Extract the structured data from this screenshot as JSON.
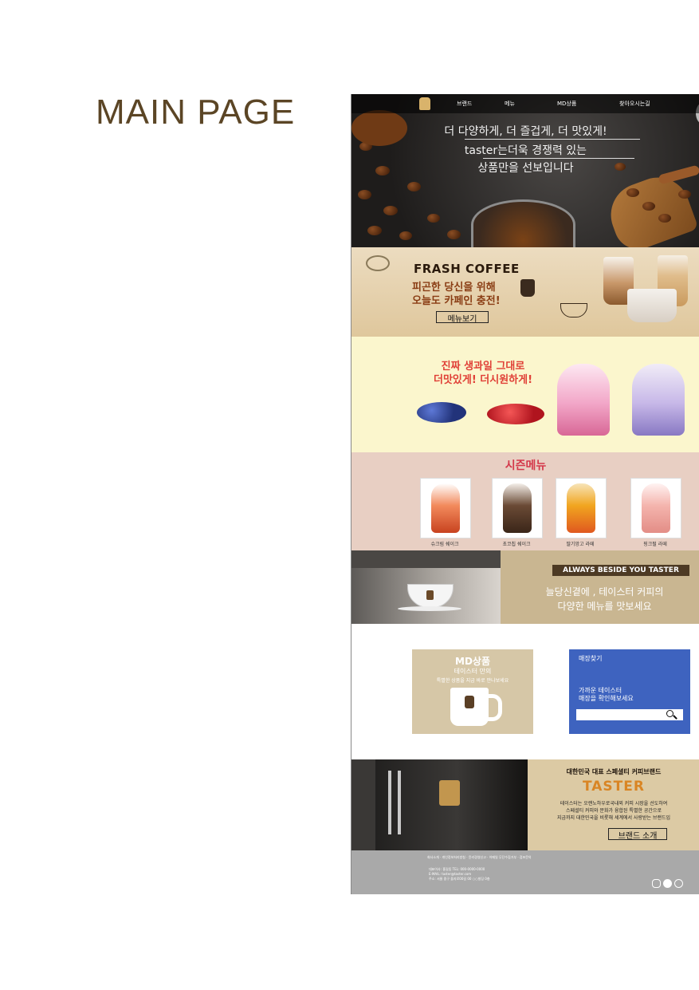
{
  "page_heading": "MAIN PAGE",
  "nav": {
    "items": [
      "브랜드",
      "메뉴",
      "MD상품",
      "찾아오시는길"
    ]
  },
  "hero": {
    "lines": [
      "더 다양하게, 더 즐겁게, 더 맛있게!",
      "taster는더욱 경쟁력 있는",
      "상품만을 선보입니다"
    ]
  },
  "fresh": {
    "title": "FRASH COFFEE",
    "line1": "피곤한 당신을 위해",
    "line2": "오늘도 카페인 충전!",
    "button": "메뉴보기"
  },
  "fruit": {
    "line1": "진짜 생과일 그대로",
    "line2": "더맛있게! 더시원하게!"
  },
  "season": {
    "title": "시즌메뉴",
    "items": [
      "슈크림 쉐이크",
      "초코칩 쉐이크",
      "딸기망고 라떼",
      "핑크펄 라떼"
    ]
  },
  "always": {
    "badge": "ALWAYS BESIDE YOU  TASTER",
    "line1": "늘당신곁에 , 테이스터 커피의",
    "line2": "다양한 메뉴를 맛보세요"
  },
  "md": {
    "title": "MD상품",
    "sub": "테이스터 만의",
    "desc": "특별한 상품을 지금 바로 만나보세요"
  },
  "store": {
    "title": "매장찾기",
    "line1": "가까운 테이스터",
    "line2": "매장을 확인해보세요"
  },
  "brand": {
    "kicker": "대한민국 대표 스페셜티 커피브랜드",
    "name": "TASTER",
    "desc": [
      "테이스터는 오랜노하우로국내외 커피 시장을 선도하여",
      "스페셜티 커피와 문화가 융합된 특별한 공간으로",
      "지금까지 대한민국을 비롯해 세계에서 사랑받는 브랜드입"
    ],
    "button": "브랜드 소개"
  },
  "footer": {
    "links": "회사소개  ·  개인정보처리방침  ·  윤리경영신고  ·  이메일 무단수집거부  ·  점포문의",
    "info": [
      "대표이사: 홍길동 TEL: 000-0000-0000",
      "E-MAIL: taster@taster.com",
      "주소: 서울 중구 을지로00길 00 ○○빌딩 0층"
    ]
  },
  "colors": {
    "heading": "#5b4525",
    "badge": "#4d3a24",
    "store": "#3e63bf",
    "footer": "#a9a9a9",
    "accent": "#d98524"
  },
  "icons": [
    "search-icon",
    "instagram-icon",
    "facebook-icon",
    "mail-icon",
    "logo-icon"
  ]
}
